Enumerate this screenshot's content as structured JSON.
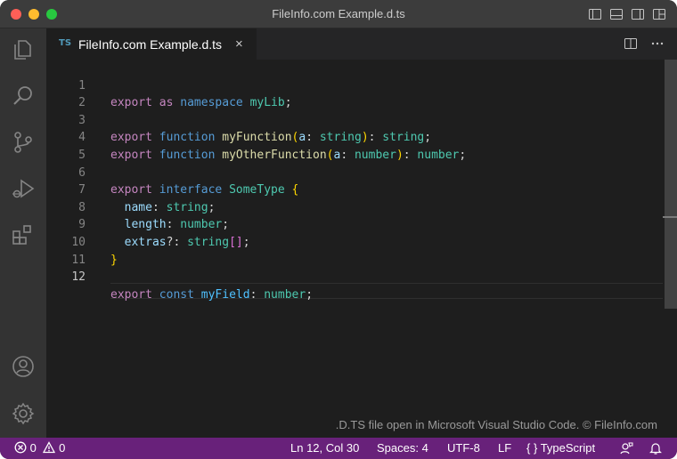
{
  "window": {
    "title": "FileInfo.com Example.d.ts"
  },
  "tab": {
    "icon_text": "TS",
    "label": "FileInfo.com Example.d.ts",
    "close": "×"
  },
  "code": {
    "lines": [
      {
        "n": "1"
      },
      {
        "n": "2"
      },
      {
        "n": "3"
      },
      {
        "n": "4"
      },
      {
        "n": "5"
      },
      {
        "n": "6"
      },
      {
        "n": "7"
      },
      {
        "n": "8"
      },
      {
        "n": "9"
      },
      {
        "n": "10"
      },
      {
        "n": "11"
      },
      {
        "n": "12"
      }
    ],
    "active_line": "12",
    "tokens": {
      "export": "export",
      "as": "as",
      "namespace": "namespace",
      "myLib": "myLib",
      "function": "function",
      "myFunction": "myFunction",
      "a": "a",
      "string": "string",
      "myOtherFunction": "myOtherFunction",
      "number": "number",
      "interface": "interface",
      "SomeType": "SomeType",
      "name": "name",
      "length": "length",
      "extras": "extras",
      "const": "const",
      "myField": "myField"
    }
  },
  "credit": ".D.TS file open in Microsoft Visual Studio Code. © FileInfo.com",
  "statusbar": {
    "errors": "0",
    "warnings": "0",
    "position": "Ln 12, Col 30",
    "spaces": "Spaces: 4",
    "encoding": "UTF-8",
    "eol": "LF",
    "language": "TypeScript",
    "language_icon": "{ }"
  },
  "colors": {
    "statusbar": "#68217a",
    "activitybar": "#333333",
    "editor": "#1e1e1e",
    "titlebar": "#3c3c3c"
  },
  "icons": [
    "explorer-icon",
    "search-icon",
    "source-control-icon",
    "run-debug-icon",
    "extensions-icon",
    "account-icon",
    "settings-gear-icon",
    "split-editor-icon",
    "more-actions-icon",
    "error-icon",
    "warning-icon",
    "feedback-icon",
    "bell-icon"
  ]
}
